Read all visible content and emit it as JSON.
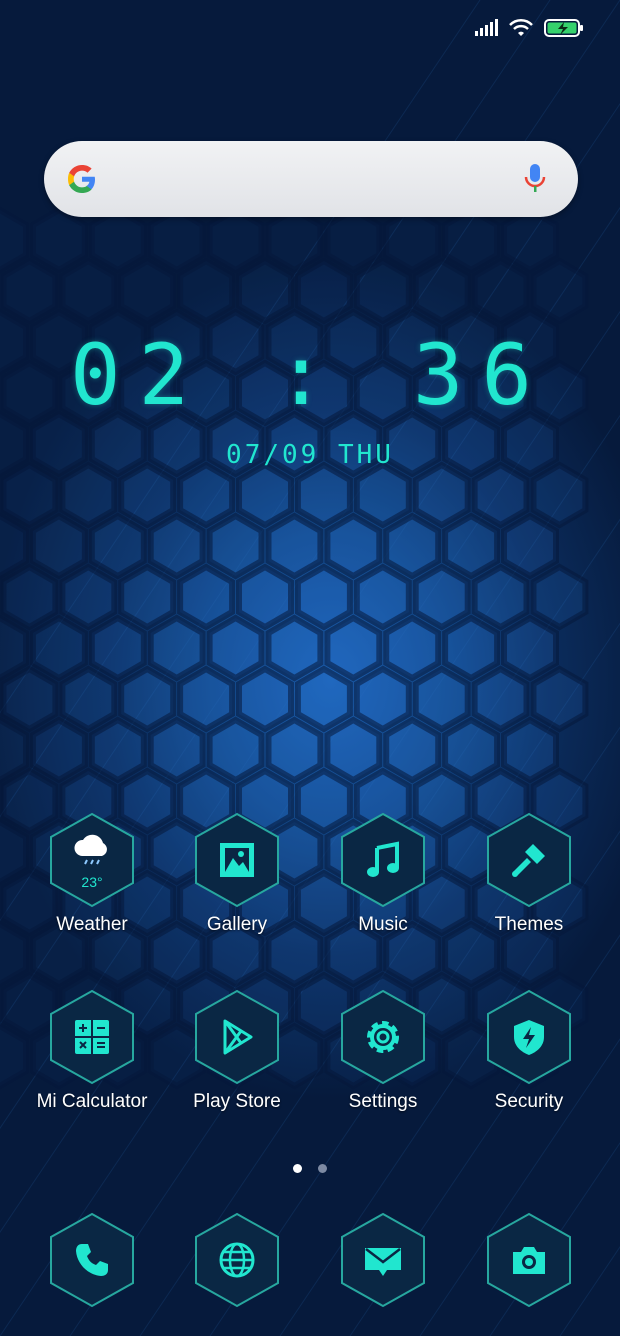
{
  "status": {
    "signal_icon": "signal-icon",
    "wifi_icon": "wifi-icon",
    "battery_icon": "battery-charging-icon"
  },
  "search": {
    "logo_icon": "google-g-icon",
    "mic_icon": "mic-icon"
  },
  "clock": {
    "time": "02 : 36",
    "date": "07/09 THU"
  },
  "apps": [
    {
      "label": "Weather",
      "icon": "cloud-rain-icon",
      "temp": "23°"
    },
    {
      "label": "Gallery",
      "icon": "gallery-icon"
    },
    {
      "label": "Music",
      "icon": "music-note-icon"
    },
    {
      "label": "Themes",
      "icon": "paintbrush-icon"
    },
    {
      "label": "Mi Calculator",
      "icon": "calculator-icon"
    },
    {
      "label": "Play Store",
      "icon": "play-store-icon"
    },
    {
      "label": "Settings",
      "icon": "gear-icon"
    },
    {
      "label": "Security",
      "icon": "shield-bolt-icon"
    }
  ],
  "dock": [
    {
      "icon": "phone-icon"
    },
    {
      "icon": "globe-icon"
    },
    {
      "icon": "mail-icon"
    },
    {
      "icon": "camera-icon"
    }
  ],
  "pages": {
    "count": 2,
    "active": 1
  },
  "colors": {
    "accent": "#21e6cf",
    "hex_fill": "#0b2a4a",
    "hex_border": "#2aa8a0"
  }
}
